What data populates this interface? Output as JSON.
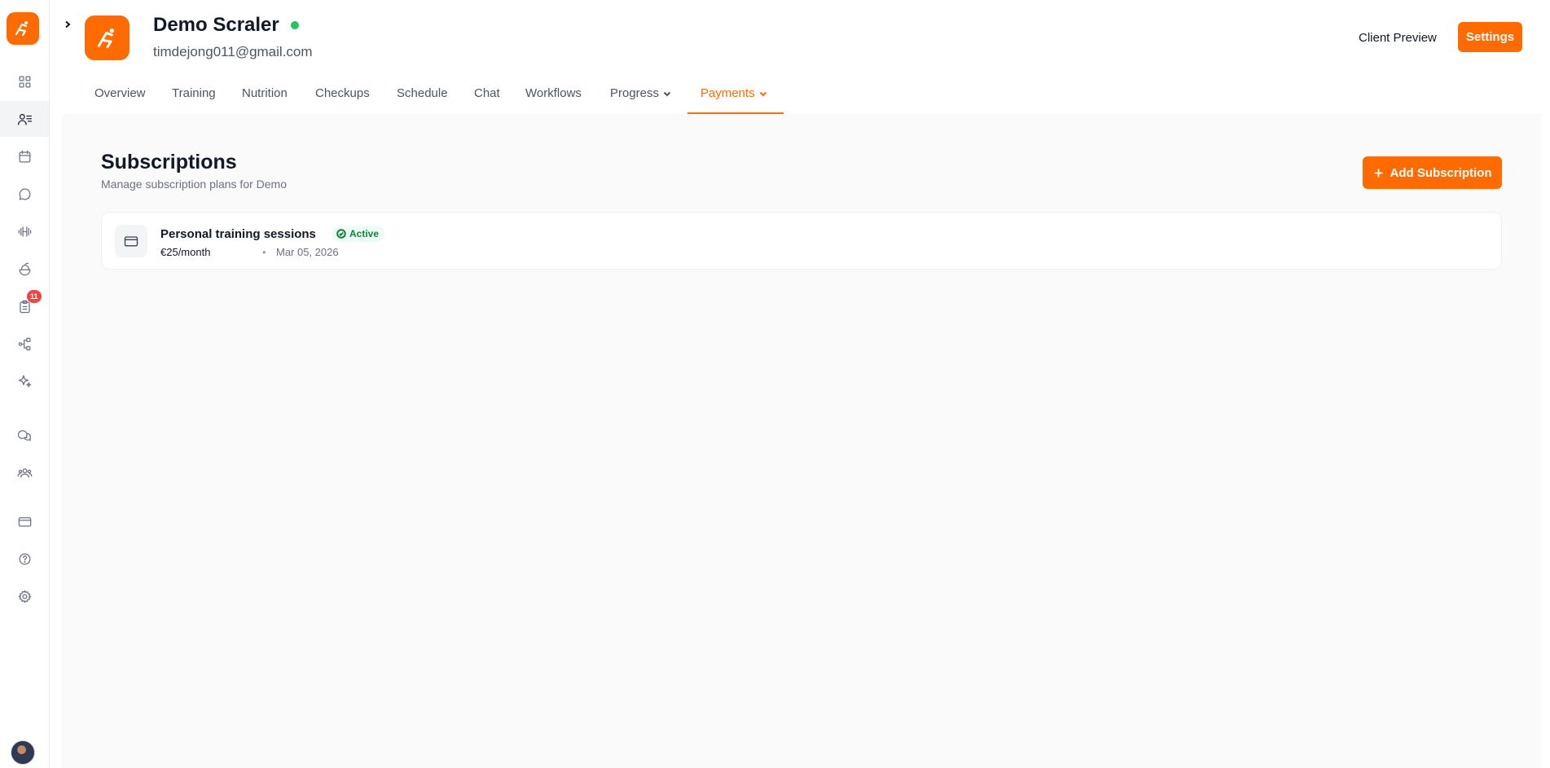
{
  "header": {
    "client_name": "Demo Scraler",
    "client_email": "timdejong011@gmail.com",
    "client_preview_label": "Client Preview",
    "settings_label": "Settings"
  },
  "tabs": [
    {
      "label": "Overview"
    },
    {
      "label": "Training"
    },
    {
      "label": "Nutrition"
    },
    {
      "label": "Checkups"
    },
    {
      "label": "Schedule"
    },
    {
      "label": "Chat"
    },
    {
      "label": "Workflows"
    },
    {
      "label": "Progress",
      "has_dropdown": true
    },
    {
      "label": "Payments",
      "has_dropdown": true,
      "active": true
    }
  ],
  "sidebar": {
    "items": [
      {
        "icon": "grid-icon"
      },
      {
        "icon": "clients-icon",
        "active": true
      },
      {
        "icon": "calendar-icon"
      },
      {
        "icon": "chat-bubble-icon"
      },
      {
        "icon": "dumbbell-icon"
      },
      {
        "icon": "salad-bowl-icon"
      },
      {
        "icon": "clipboard-icon",
        "badge": "11"
      },
      {
        "icon": "workflow-icon"
      },
      {
        "icon": "sparkles-icon"
      },
      {
        "icon": "messages-icon"
      },
      {
        "icon": "community-icon"
      },
      {
        "icon": "credit-card-icon"
      },
      {
        "icon": "help-icon"
      },
      {
        "icon": "gear-icon"
      }
    ]
  },
  "subscriptions": {
    "title": "Subscriptions",
    "subtitle": "Manage subscription plans for Demo",
    "add_button_label": "Add Subscription",
    "items": [
      {
        "name": "Personal training sessions",
        "status": "Active",
        "price": "€25/month",
        "separator": "•",
        "date": "Mar 05, 2026"
      }
    ]
  },
  "colors": {
    "brand": "#ff6b00",
    "status_active": "#15803d",
    "online": "#22c55e",
    "badge": "#ef4444"
  }
}
